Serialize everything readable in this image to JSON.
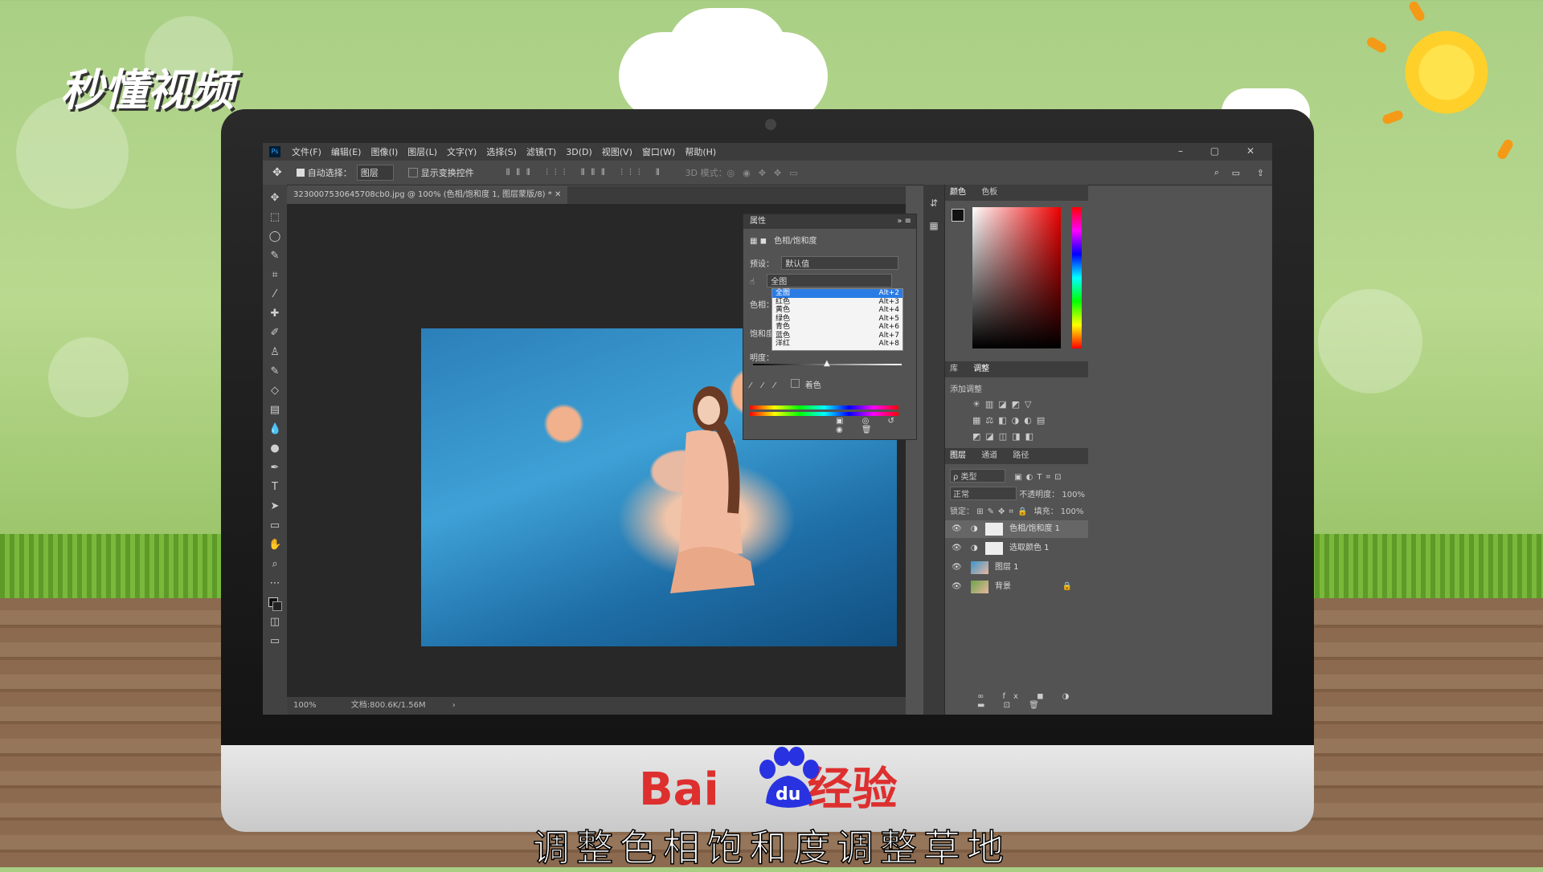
{
  "watermark": {
    "logo_text": "秒懂视频"
  },
  "ps": {
    "menu": [
      "文件(F)",
      "编辑(E)",
      "图像(I)",
      "图层(L)",
      "文字(Y)",
      "选择(S)",
      "滤镜(T)",
      "3D(D)",
      "视图(V)",
      "窗口(W)",
      "帮助(H)"
    ],
    "window_controls": [
      "–",
      "▢",
      "✕"
    ],
    "options": {
      "auto_select_label": "自动选择：",
      "auto_select_value": "图层",
      "show_transform_label": "显示变换控件",
      "mode3d_label": "3D 模式："
    },
    "doc_tab": "3230007530645708cb0.jpg @ 100% (色相/饱和度 1, 图层蒙版/8) *",
    "status": {
      "zoom": "100%",
      "doc_info": "文档:800.6K/1.56M"
    },
    "properties": {
      "title": "属性",
      "adjustment_name": "色相/饱和度",
      "preset_label": "预设：",
      "preset_value": "默认值",
      "channel_value": "全图",
      "hue_label": "色相：",
      "sat_label": "饱和度：",
      "light_label": "明度：",
      "colorize_label": "着色",
      "channel_options": [
        {
          "label": "全图",
          "shortcut": "Alt+2"
        },
        {
          "label": "红色",
          "shortcut": "Alt+3"
        },
        {
          "label": "黄色",
          "shortcut": "Alt+4"
        },
        {
          "label": "绿色",
          "shortcut": "Alt+5"
        },
        {
          "label": "青色",
          "shortcut": "Alt+6"
        },
        {
          "label": "蓝色",
          "shortcut": "Alt+7"
        },
        {
          "label": "洋红",
          "shortcut": "Alt+8"
        }
      ]
    },
    "color_panel": {
      "tabs": [
        "颜色",
        "色板"
      ]
    },
    "adjust_panel": {
      "tabs": [
        "库",
        "调整"
      ],
      "add_label": "添加调整"
    },
    "layers_panel": {
      "tabs": [
        "图层",
        "通道",
        "路径"
      ],
      "kind_label": "ρ 类型",
      "blend_mode": "正常",
      "opacity_label": "不透明度：",
      "opacity_value": "100%",
      "lock_label": "锁定：",
      "fill_label": "填充：",
      "fill_value": "100%",
      "layers": [
        {
          "name": "色相/饱和度 1"
        },
        {
          "name": "选取颜色 1"
        },
        {
          "name": "图层 1"
        },
        {
          "name": "背景"
        }
      ]
    }
  },
  "brand": {
    "text": "Bai",
    "text2": "经验",
    "paw_text": "du"
  },
  "caption": "调整色相饱和度调整草地",
  "colors": {
    "ps_bg": "#535353",
    "accent": "#2a7be4",
    "baidu_red": "#de2f2f",
    "baidu_blue": "#2932e1"
  }
}
